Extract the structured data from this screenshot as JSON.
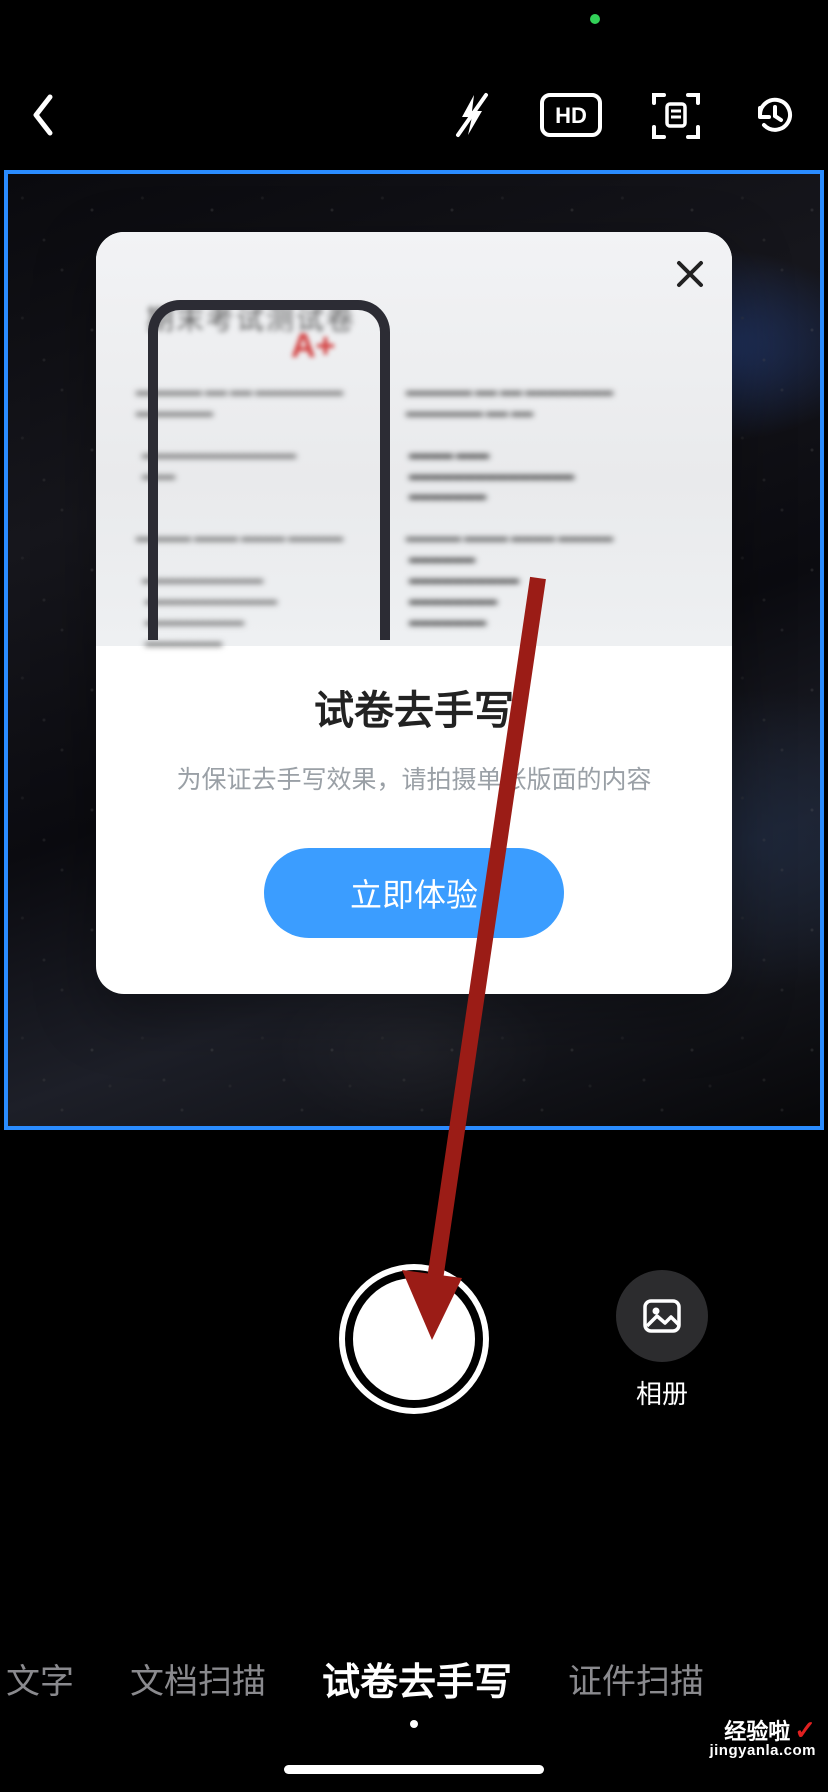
{
  "toolbar": {
    "hd_label": "HD"
  },
  "modal": {
    "illustration": {
      "paper_title_blur": "期末考试测试卷",
      "grade": "A+"
    },
    "title": "试卷去手写",
    "subtitle": "为保证去手写效果，请拍摄单张版面的内容",
    "cta_label": "立即体验"
  },
  "album": {
    "label": "相册"
  },
  "modes": {
    "items": [
      {
        "label": "文字",
        "active": false
      },
      {
        "label": "文档扫描",
        "active": false
      },
      {
        "label": "试卷去手写",
        "active": true
      },
      {
        "label": "证件扫描",
        "active": false
      }
    ]
  },
  "watermark": {
    "line1": "经验啦",
    "check": "✓",
    "line2": "jingyanla.com"
  },
  "annotation": {
    "arrow_color": "#9b1c16"
  }
}
